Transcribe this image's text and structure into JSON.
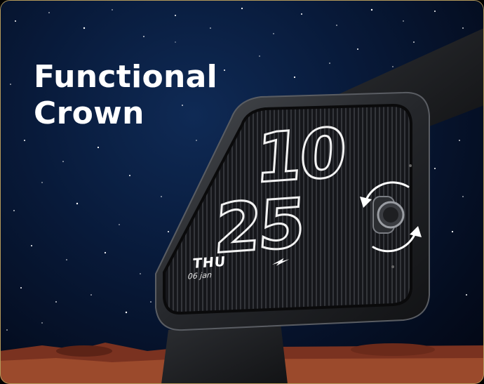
{
  "headline": {
    "line1": "Functional",
    "line2": "Crown"
  },
  "watch_face": {
    "hours": "10",
    "minutes": "25",
    "day": "THU",
    "date": "06 jan"
  },
  "icons": {
    "crown_rotation": "rotate-arrows-icon",
    "brand": "fastrack-arrow-icon"
  },
  "colors": {
    "sky": "#081a3a",
    "ground": "#8a3a22",
    "text": "#ffffff",
    "frame_border": "#b59a5a"
  }
}
